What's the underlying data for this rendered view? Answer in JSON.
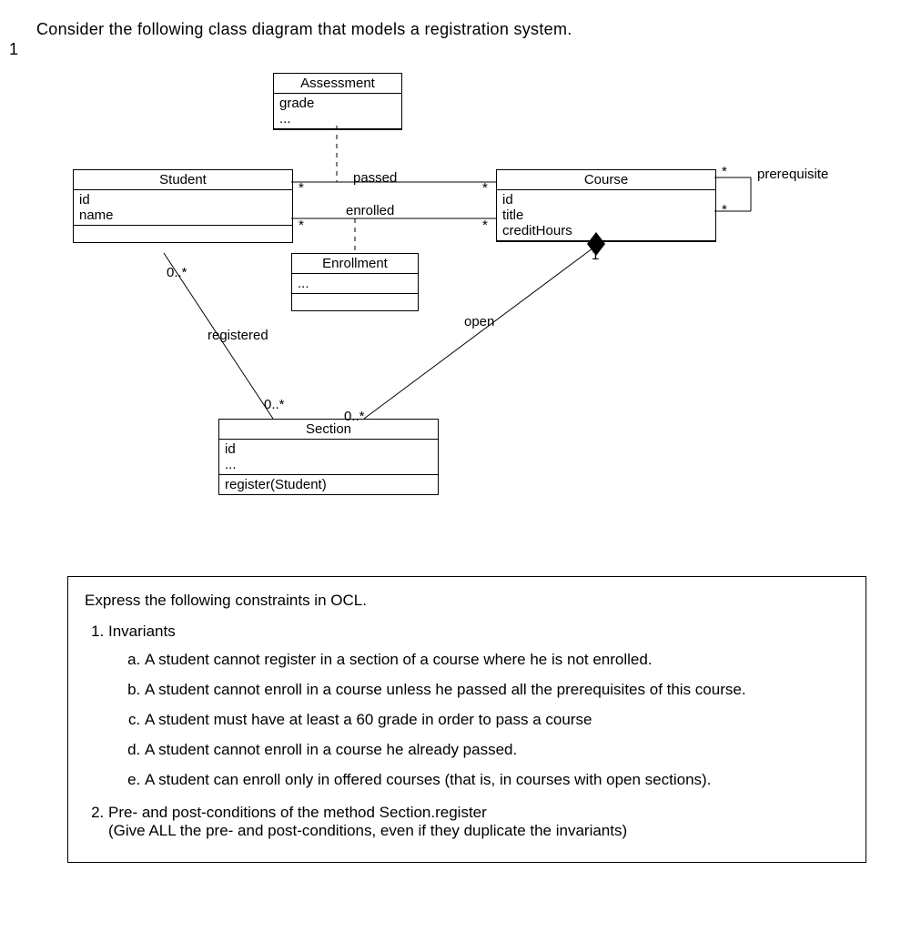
{
  "intro": "Consider the following class diagram that models a registration system.",
  "question_number": "1",
  "classes": {
    "assessment": {
      "name": "Assessment",
      "attrs": [
        "grade",
        "..."
      ]
    },
    "student": {
      "name": "Student",
      "attrs": [
        "id",
        "name"
      ]
    },
    "course": {
      "name": "Course",
      "attrs": [
        "id",
        "title",
        "creditHours"
      ]
    },
    "enrollment": {
      "name": "Enrollment",
      "attrs": [
        "..."
      ]
    },
    "section": {
      "name": "Section",
      "attrs": [
        "id",
        "..."
      ],
      "ops": [
        "register(Student)"
      ]
    }
  },
  "assoc": {
    "passed": "passed",
    "enrolled": "enrolled",
    "prerequisite": "prerequisite",
    "registered": "registered",
    "open": "open"
  },
  "mult": {
    "star": "*",
    "zero_star": "0..*",
    "one": "1"
  },
  "constraints": {
    "lead": "Express the following constraints in OCL.",
    "invariants_title": "Invariants",
    "items": [
      "A student cannot register in a section of a course where he is not enrolled.",
      "A student cannot enroll in a course unless he passed all the prerequisites of this course.",
      "A student must have at least a 60 grade in order to pass a course",
      "A student cannot enroll in a course he already passed.",
      "A student can enroll only in offered courses (that is, in courses with open sections)."
    ],
    "prepost_title": "Pre-  and  post-conditions  of  the  method  Section.register",
    "prepost_note": "(Give ALL the pre- and post-conditions, even if they duplicate the invariants)"
  }
}
